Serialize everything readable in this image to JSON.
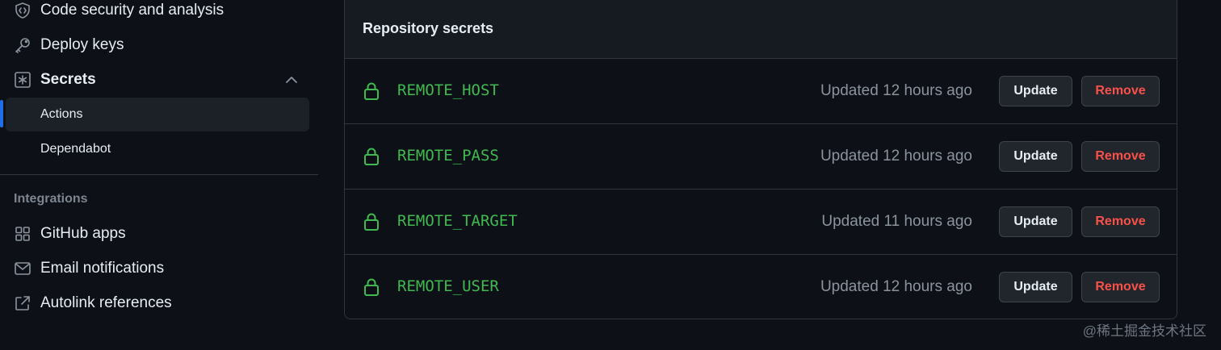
{
  "sidebar": {
    "items": [
      {
        "label": "Code security and analysis",
        "icon": "code-security-icon"
      },
      {
        "label": "Deploy keys",
        "icon": "key-icon"
      },
      {
        "label": "Secrets",
        "icon": "asterisk-icon"
      }
    ],
    "secrets_subitems": [
      {
        "label": "Actions",
        "active": true
      },
      {
        "label": "Dependabot",
        "active": false
      }
    ],
    "integrations_heading": "Integrations",
    "integrations": [
      {
        "label": "GitHub apps",
        "icon": "apps-icon"
      },
      {
        "label": "Email notifications",
        "icon": "mail-icon"
      },
      {
        "label": "Autolink references",
        "icon": "link-external-icon"
      }
    ]
  },
  "secrets_box": {
    "title": "Repository secrets",
    "update_label": "Update",
    "remove_label": "Remove",
    "rows": [
      {
        "name": "REMOTE_HOST",
        "updated": "Updated 12 hours ago"
      },
      {
        "name": "REMOTE_PASS",
        "updated": "Updated 12 hours ago"
      },
      {
        "name": "REMOTE_TARGET",
        "updated": "Updated 11 hours ago"
      },
      {
        "name": "REMOTE_USER",
        "updated": "Updated 12 hours ago"
      }
    ]
  },
  "watermark": "@稀土掘金技术社区",
  "colors": {
    "background": "#0d1117",
    "secret_name": "#3fb950",
    "remove_text": "#f85149",
    "active_accent": "#1f6feb"
  }
}
